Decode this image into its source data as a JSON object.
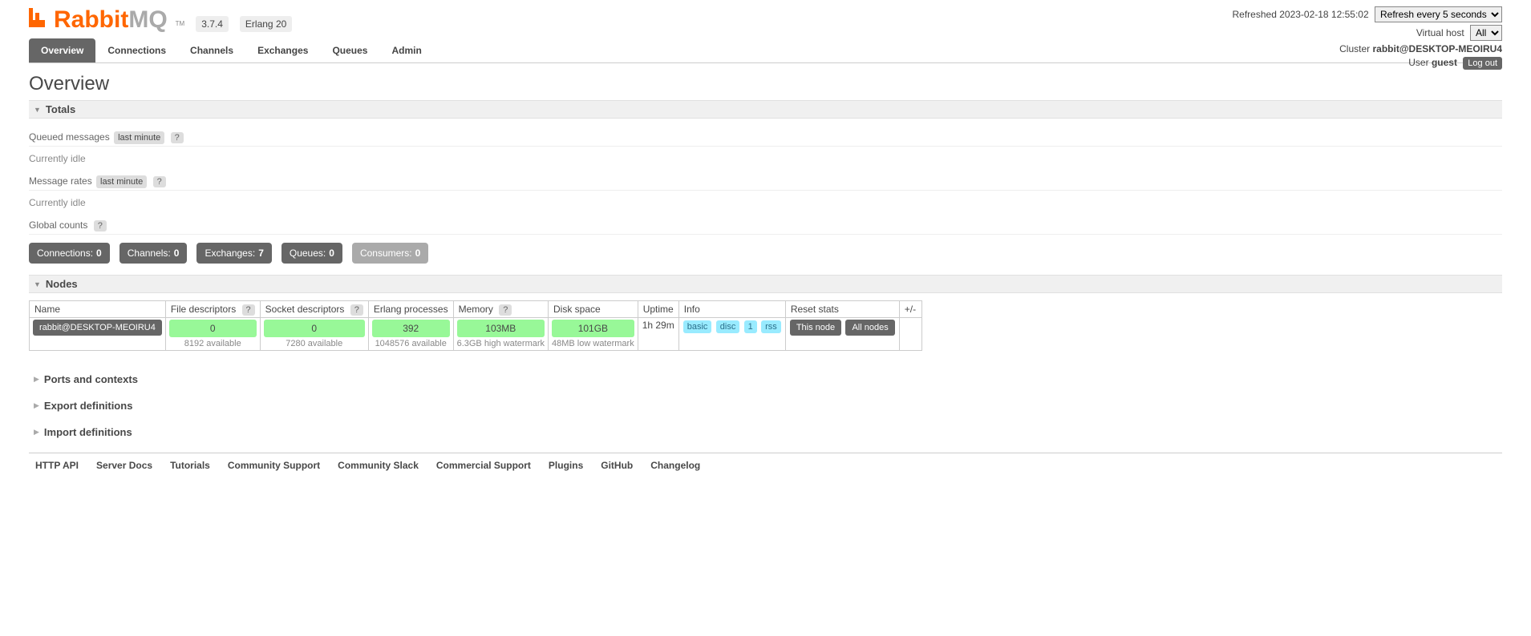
{
  "brand": {
    "rabbit": "Rabbit",
    "mq": "MQ",
    "tm": "TM"
  },
  "versions": {
    "rabbit": "3.7.4",
    "erlang": "Erlang 20"
  },
  "top": {
    "refreshed_label": "Refreshed",
    "refreshed_time": "2023-02-18 12:55:02",
    "refresh_selected": "Refresh every 5 seconds",
    "vhost_label": "Virtual host",
    "vhost_selected": "All",
    "cluster_label": "Cluster",
    "cluster_name": "rabbit@DESKTOP-MEOIRU4",
    "user_label": "User",
    "user_name": "guest",
    "logout": "Log out"
  },
  "tabs": [
    "Overview",
    "Connections",
    "Channels",
    "Exchanges",
    "Queues",
    "Admin"
  ],
  "page_title": "Overview",
  "totals": {
    "heading": "Totals",
    "queued_label": "Queued messages",
    "queued_range": "last minute",
    "queued_idle": "Currently idle",
    "rates_label": "Message rates",
    "rates_range": "last minute",
    "rates_idle": "Currently idle",
    "global_label": "Global counts",
    "help": "?",
    "counts": {
      "connections_label": "Connections:",
      "connections_value": "0",
      "channels_label": "Channels:",
      "channels_value": "0",
      "exchanges_label": "Exchanges:",
      "exchanges_value": "7",
      "queues_label": "Queues:",
      "queues_value": "0",
      "consumers_label": "Consumers:",
      "consumers_value": "0"
    }
  },
  "nodes": {
    "heading": "Nodes",
    "cols": {
      "name": "Name",
      "fd": "File descriptors",
      "sd": "Socket descriptors",
      "ep": "Erlang processes",
      "mem": "Memory",
      "disk": "Disk space",
      "uptime": "Uptime",
      "info": "Info",
      "reset": "Reset stats",
      "plusminus": "+/-"
    },
    "row": {
      "name": "rabbit@DESKTOP-MEOIRU4",
      "fd_value": "0",
      "fd_sub": "8192 available",
      "sd_value": "0",
      "sd_sub": "7280 available",
      "ep_value": "392",
      "ep_sub": "1048576 available",
      "mem_value": "103MB",
      "mem_sub": "6.3GB high watermark",
      "disk_value": "101GB",
      "disk_sub": "48MB low watermark",
      "uptime": "1h 29m",
      "info_basic": "basic",
      "info_disc": "disc",
      "info_one": "1",
      "info_rss": "rss",
      "reset_this": "This node",
      "reset_all": "All nodes"
    }
  },
  "collapsed": {
    "ports": "Ports and contexts",
    "export": "Export definitions",
    "import": "Import definitions"
  },
  "footer": [
    "HTTP API",
    "Server Docs",
    "Tutorials",
    "Community Support",
    "Community Slack",
    "Commercial Support",
    "Plugins",
    "GitHub",
    "Changelog"
  ]
}
